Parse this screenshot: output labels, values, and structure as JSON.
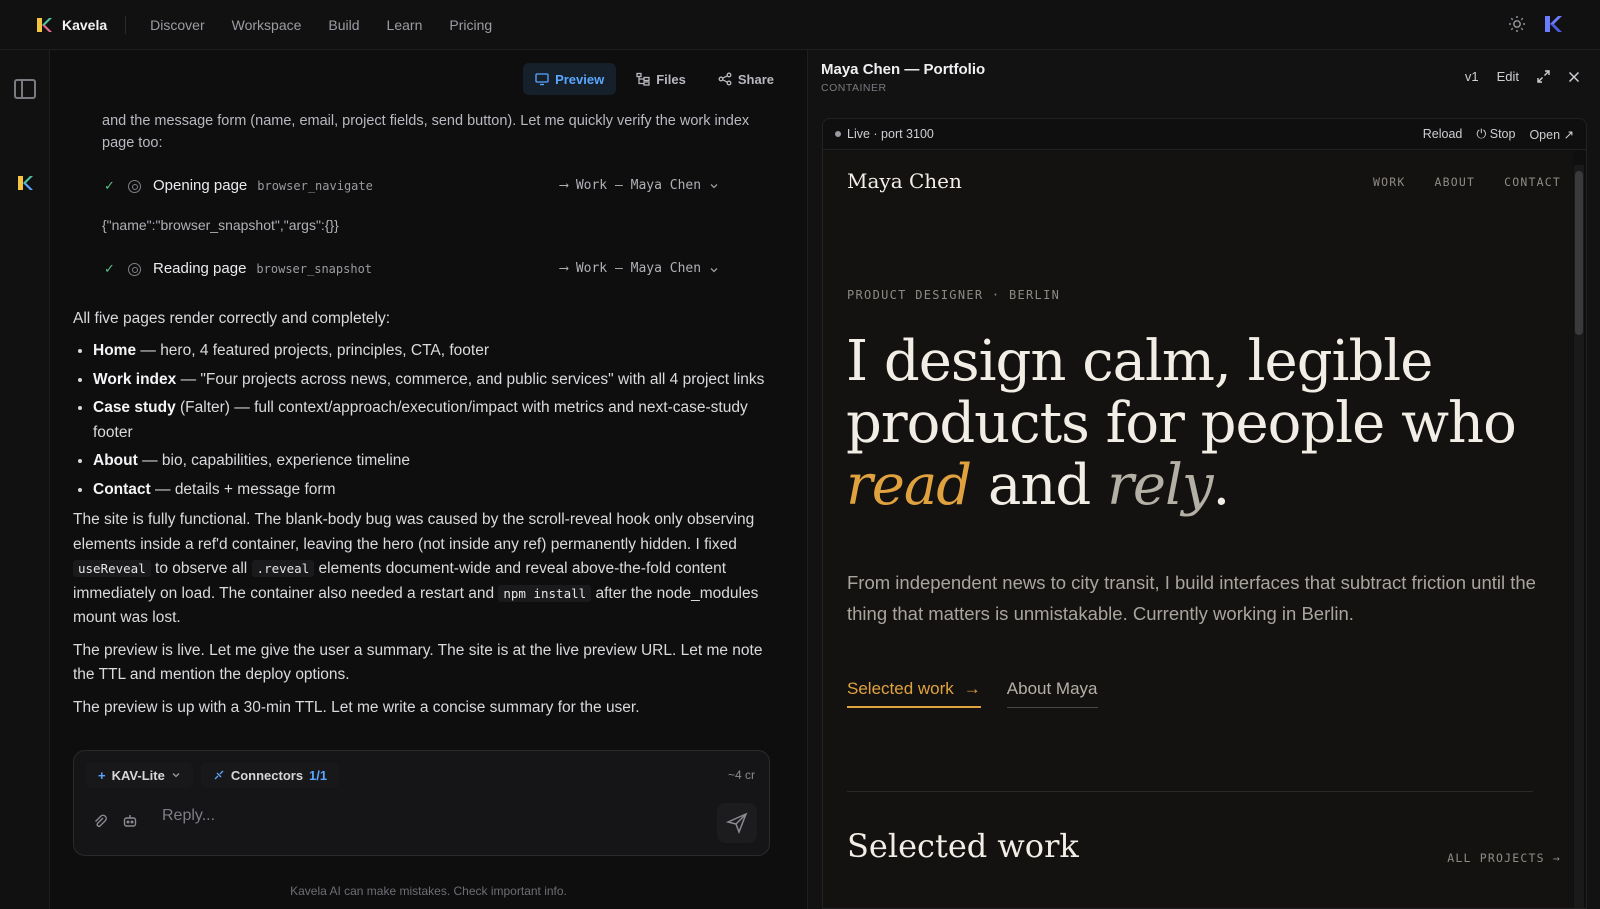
{
  "topnav": {
    "brand": "Kavela",
    "links": [
      "Discover",
      "Workspace",
      "Build",
      "Learn",
      "Pricing"
    ]
  },
  "colors": {
    "brand_accent": "#5aa7ff",
    "site_accent": "#e0a23f",
    "success": "#57c080"
  },
  "chat": {
    "toolbar": {
      "preview": "Preview",
      "files": "Files",
      "share": "Share"
    },
    "intro_text": "and the message form (name, email, project fields, send button). Let me quickly verify the work index page too:",
    "tools": [
      {
        "title": "Opening page",
        "code": "browser_navigate",
        "result": "Work — Maya Chen"
      },
      {
        "title": "Reading page",
        "code": "browser_snapshot",
        "result": "Work — Maya Chen"
      }
    ],
    "json_line": "{\"name\":\"browser_snapshot\",\"args\":{}}",
    "summary_lead": "All five pages render correctly and completely:",
    "bullets": [
      {
        "bold": "Home",
        "text": " — hero, 4 featured projects, principles, CTA, footer"
      },
      {
        "bold": "Work index",
        "text": " — \"Four projects across news, commerce, and public services\" with all 4 project links"
      },
      {
        "bold": "Case study",
        "text": " (Falter) — full context/approach/execution/impact with metrics and next-case-study footer"
      },
      {
        "bold": "About",
        "text": " — bio, capabilities, experience timeline"
      },
      {
        "bold": "Contact",
        "text": " — details + message form"
      }
    ],
    "para1": {
      "a": "The site is fully functional. The blank-body bug was caused by the scroll-reveal hook only observing elements inside a ref'd container, leaving the hero (not inside any ref) permanently hidden. I fixed ",
      "code1": "useReveal",
      "b": " to observe all ",
      "code2": ".reveal",
      "c": " elements document-wide and reveal above-the-fold content immediately on load. The container also needed a restart and ",
      "code3": "npm install",
      "d": " after the node_modules mount was lost."
    },
    "para2": "The preview is live. Let me give the user a summary. The site is at the live preview URL. Let me note the TTL and mention the deploy options.",
    "para3": "The preview is up with a 30-min TTL. Let me write a concise summary for the user."
  },
  "composer": {
    "model": "KAV-Lite",
    "connectors_label": "Connectors",
    "connectors_count": "1/1",
    "credits": "~4 cr",
    "placeholder": "Reply...",
    "disclaimer": "Kavela AI can make mistakes. Check important info."
  },
  "preview": {
    "title": "Maya Chen — Portfolio",
    "subtitle": "CONTAINER",
    "version": "v1",
    "edit": "Edit",
    "live": "Live · port 3100",
    "reload": "Reload",
    "stop": "Stop",
    "open": "Open"
  },
  "site": {
    "logo": "Maya Chen",
    "nav": [
      "WORK",
      "ABOUT",
      "CONTACT"
    ],
    "eyebrow": "PRODUCT DESIGNER · BERLIN",
    "hero_a": "I design calm, legible products for people who ",
    "hero_accent": "read",
    "hero_mid": " and ",
    "hero_soft": "rely",
    "hero_end": ".",
    "lede": "From independent news to city transit, I build interfaces that subtract friction until the thing that matters is unmistakable. Currently working in Berlin.",
    "cta_primary": "Selected work",
    "cta_arrow": "→",
    "cta_secondary": "About Maya",
    "section_title": "Selected work",
    "all_projects": "ALL PROJECTS →"
  }
}
